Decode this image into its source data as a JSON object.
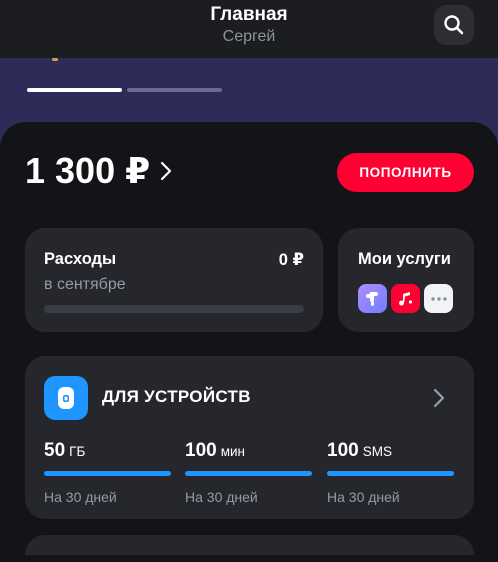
{
  "header": {
    "title": "Главная",
    "subtitle": "Сергей",
    "search_icon": "search-icon"
  },
  "banner": {
    "background": "#2e2b59",
    "slides_total": 2,
    "active_slide": 1
  },
  "balance": {
    "amount": "1 300 ₽",
    "chevron_icon": "chevron-right-icon"
  },
  "topup": {
    "label": "ПОПОЛНИТЬ",
    "color": "#ff0032"
  },
  "expenses": {
    "title": "Расходы",
    "amount": "0 ₽",
    "period": "в сентябре",
    "progress": 0
  },
  "services": {
    "title": "Мои услуги",
    "icons": [
      "plus-service-icon",
      "music-icon",
      "more-icon"
    ]
  },
  "tariff": {
    "name": "ДЛЯ УСТРОЙСТВ",
    "icon": "device-sim-icon",
    "accent": "#1e95ff",
    "quotas": [
      {
        "value": "50",
        "unit": "ГБ",
        "period": "На 30 дней",
        "fill": 1
      },
      {
        "value": "100",
        "unit": "мин",
        "period": "На 30 дней",
        "fill": 1
      },
      {
        "value": "100",
        "unit": "SMS",
        "period": "На 30 дней",
        "fill": 1
      }
    ]
  }
}
